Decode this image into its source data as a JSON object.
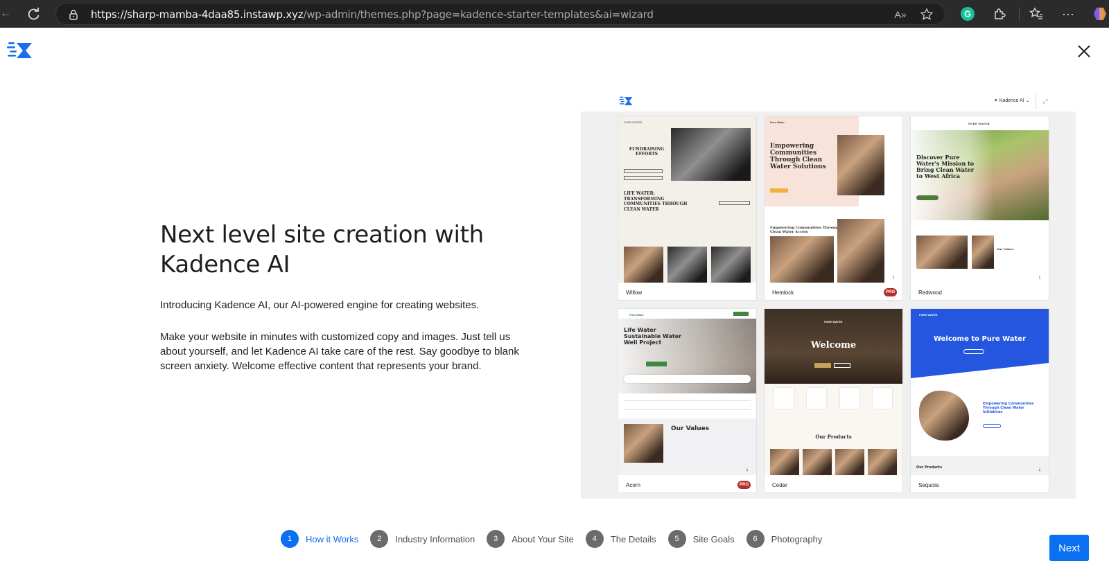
{
  "browser": {
    "url_host": "https://sharp-mamba-4daa85.instawp.xyz",
    "url_path": "/wp-admin/themes.php?page=kadence-starter-templates&ai=wizard",
    "icons": [
      "back-icon",
      "reload-icon",
      "lock-icon",
      "read-aloud-icon",
      "favorite-star-icon",
      "grammarly-icon",
      "extensions-icon",
      "favorites-icon",
      "more-icon",
      "copilot-icon"
    ]
  },
  "header": {
    "logo_icon": "kadence-logo-icon",
    "close_icon": "close-icon"
  },
  "hero": {
    "title": "Next level site creation with Kadence AI",
    "intro": "Introducing Kadence AI, our AI-powered engine for creating websites.",
    "body": "Make your website in minutes with customized copy and images. Just tell us about yourself, and let Kadence AI take care of the rest. Say goodbye to blank screen anxiety. Welcome effective content that represents your brand."
  },
  "preview": {
    "kadence_ai_label": "Kadence AI",
    "templates": [
      {
        "name": "Willow",
        "pro": false,
        "headline": "FUNDRAISING EFFORTS",
        "sub": "LIFE WATER: TRANSFORMING COMMUNITIES THROUGH CLEAN WATER",
        "brand": "PURE WATER"
      },
      {
        "name": "Hemlock",
        "pro": true,
        "headline": "Empowering Communities Through Clean Water Solutions",
        "sub": "Empowering Communities Through Clean Water Access",
        "brand": "Pure Water"
      },
      {
        "name": "Redwood",
        "pro": false,
        "headline": "Discover Pure Water's Mission to Bring Clean Water to West Africa",
        "sub": "Our Values",
        "brand": "PURE WATER"
      },
      {
        "name": "Acorn",
        "pro": true,
        "headline": "Life Water Sustainable Water Well Project",
        "sub": "Our Values",
        "brand": "Pure Water"
      },
      {
        "name": "Cedar",
        "pro": false,
        "headline": "Welcome",
        "sub": "Our Products",
        "brand": "PURE WATER"
      },
      {
        "name": "Sequoia",
        "pro": false,
        "headline": "Welcome to Pure Water",
        "sub": "Empowering Communities Through Clean Water Initiatives",
        "footer": "Our Products",
        "brand": "PURE WATER"
      }
    ],
    "pro_badge": "PRO"
  },
  "steps": [
    {
      "num": "1",
      "label": "How it Works",
      "active": true
    },
    {
      "num": "2",
      "label": "Industry Information",
      "active": false
    },
    {
      "num": "3",
      "label": "About Your Site",
      "active": false
    },
    {
      "num": "4",
      "label": "The Details",
      "active": false
    },
    {
      "num": "5",
      "label": "Site Goals",
      "active": false
    },
    {
      "num": "6",
      "label": "Photography",
      "active": false
    }
  ],
  "next_label": "Next",
  "colors": {
    "accent": "#0a6ff0",
    "pro_badge": "#b5302c",
    "browser_bar": "#2b2b2b",
    "step_inactive": "#6b6b6b"
  }
}
